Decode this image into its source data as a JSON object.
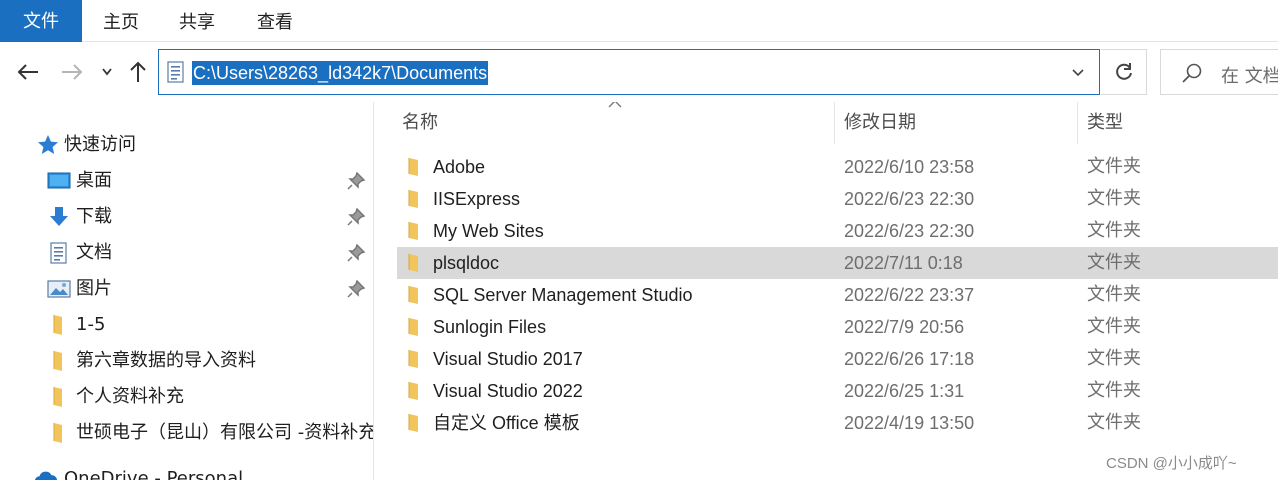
{
  "ribbon": {
    "tabs": [
      {
        "label": "文件"
      },
      {
        "label": "主页"
      },
      {
        "label": "共享"
      },
      {
        "label": "查看"
      }
    ]
  },
  "navbar": {
    "address": "C:\\Users\\28263_ld342k7\\Documents",
    "search_placeholder": "在 文档"
  },
  "sidebar": {
    "items": [
      {
        "label": "快速访问",
        "icon": "star-icon"
      },
      {
        "label": "桌面",
        "icon": "desktop-icon",
        "pinned": true
      },
      {
        "label": "下载",
        "icon": "download-icon",
        "pinned": true
      },
      {
        "label": "文档",
        "icon": "document-icon",
        "pinned": true
      },
      {
        "label": "图片",
        "icon": "picture-icon",
        "pinned": true
      },
      {
        "label": "1-5",
        "icon": "folder-icon"
      },
      {
        "label": "第六章数据的导入资料",
        "icon": "folder-icon"
      },
      {
        "label": "个人资料补充",
        "icon": "folder-icon"
      },
      {
        "label": "世硕电子（昆山）有限公司 -资料补充",
        "icon": "folder-icon"
      },
      {
        "label": "OneDrive - Personal",
        "icon": "cloud-icon"
      }
    ]
  },
  "main": {
    "columns": {
      "name": "名称",
      "date": "修改日期",
      "type": "类型"
    },
    "rows": [
      {
        "name": "Adobe",
        "date": "2022/6/10 23:58",
        "type": "文件夹"
      },
      {
        "name": "IISExpress",
        "date": "2022/6/23 22:30",
        "type": "文件夹"
      },
      {
        "name": "My Web Sites",
        "date": "2022/6/23 22:30",
        "type": "文件夹"
      },
      {
        "name": "plsqldoc",
        "date": "2022/7/11 0:18",
        "type": "文件夹",
        "selected": true
      },
      {
        "name": "SQL Server Management Studio",
        "date": "2022/6/22 23:37",
        "type": "文件夹"
      },
      {
        "name": "Sunlogin Files",
        "date": "2022/7/9 20:56",
        "type": "文件夹"
      },
      {
        "name": "Visual Studio 2017",
        "date": "2022/6/26 17:18",
        "type": "文件夹"
      },
      {
        "name": "Visual Studio 2022",
        "date": "2022/6/25 1:31",
        "type": "文件夹"
      },
      {
        "name": "自定义 Office 模板",
        "date": "2022/4/19 13:50",
        "type": "文件夹"
      }
    ]
  },
  "watermark": "CSDN @小小成吖~",
  "colors": {
    "accent": "#1a6fc0",
    "selected_row": "#d9d9d9",
    "folder": "#f2c55c"
  }
}
